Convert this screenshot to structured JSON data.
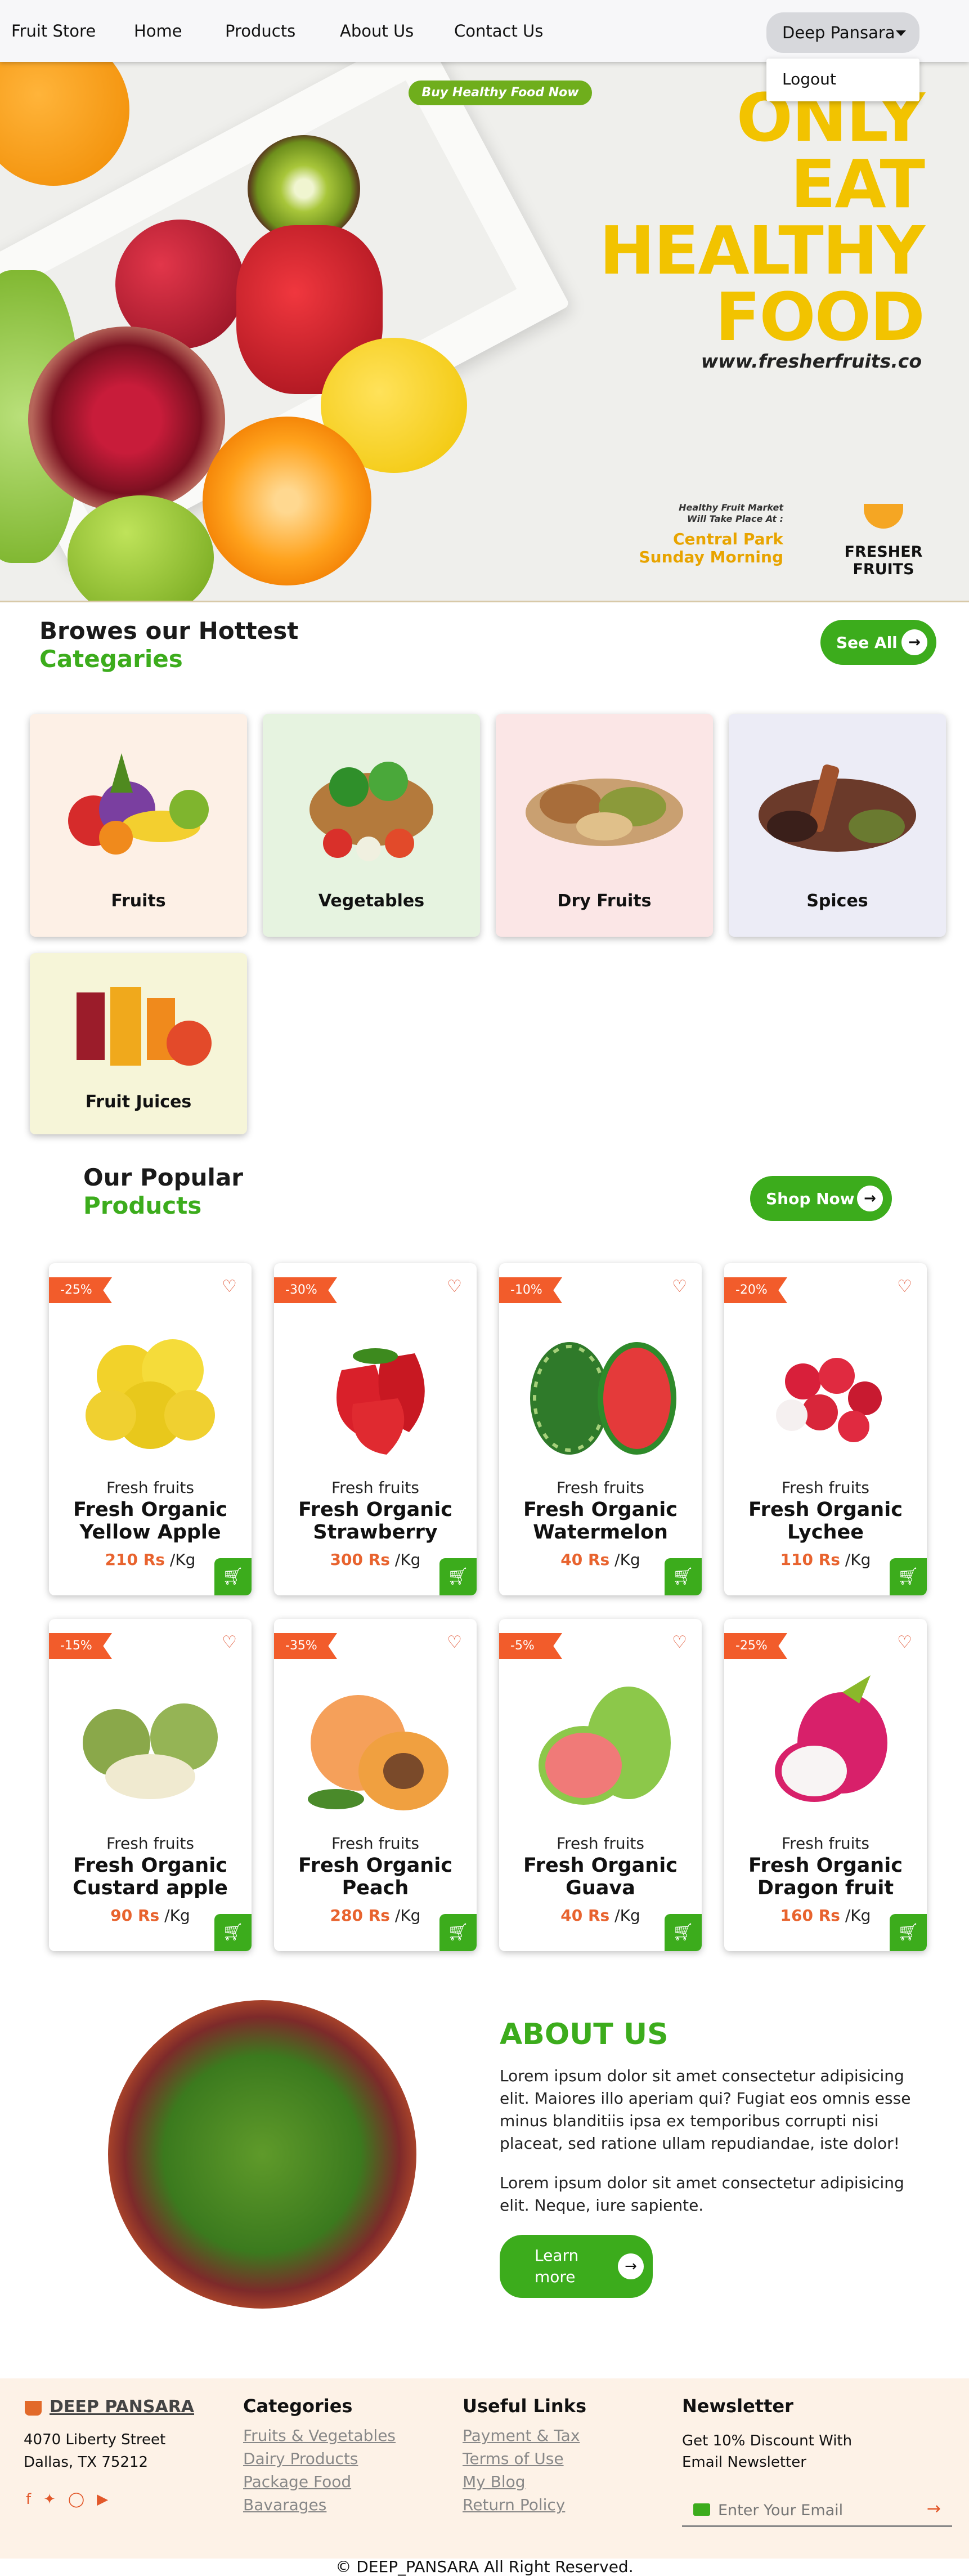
{
  "nav": {
    "brand": "Fruit Store",
    "items": [
      "Home",
      "Products",
      "About Us",
      "Contact Us"
    ],
    "user_name": "Deep Pansara",
    "dropdown_item": "Logout"
  },
  "hero": {
    "badge": "Buy Healthy Food Now",
    "title_lines": [
      "ONLY",
      "EAT",
      "HEALTHY",
      "FOOD"
    ],
    "url": "www.fresherfruits.co",
    "market_line1": "Healthy Fruit Market",
    "market_line2": "Will Take Place At :",
    "market_line3": "Central Park",
    "market_line4": "Sunday Morning",
    "logo_text": "FRESHER FRUITS"
  },
  "categories": {
    "title_line1": "Browes our Hottest",
    "title_line2": "Categaries",
    "button": "See All",
    "items": [
      {
        "label": "Fruits",
        "bg": "#fdf0e6"
      },
      {
        "label": "Vegetables",
        "bg": "#e6f3e0"
      },
      {
        "label": "Dry Fruits",
        "bg": "#fbe6e6"
      },
      {
        "label": "Spices",
        "bg": "#ececf6"
      },
      {
        "label": "Fruit Juices",
        "bg": "#f6f5d8"
      }
    ]
  },
  "products": {
    "title_line1": "Our Popular",
    "title_line2": "Products",
    "button": "Shop Now",
    "items": [
      {
        "discount": "-25%",
        "category": "Fresh fruits",
        "name1": "Fresh Organic",
        "name2": "Yellow Apple",
        "price": "210 Rs",
        "unit": "/Kg"
      },
      {
        "discount": "-30%",
        "category": "Fresh fruits",
        "name1": "Fresh Organic",
        "name2": "Strawberry",
        "price": "300 Rs",
        "unit": "/Kg"
      },
      {
        "discount": "-10%",
        "category": "Fresh fruits",
        "name1": "Fresh Organic",
        "name2": "Watermelon",
        "price": "40 Rs",
        "unit": "/Kg"
      },
      {
        "discount": "-20%",
        "category": "Fresh fruits",
        "name1": "Fresh Organic",
        "name2": "Lychee",
        "price": "110 Rs",
        "unit": "/Kg"
      },
      {
        "discount": "-15%",
        "category": "Fresh fruits",
        "name1": "Fresh Organic",
        "name2": "Custard apple",
        "price": "90 Rs",
        "unit": "/Kg"
      },
      {
        "discount": "-35%",
        "category": "Fresh fruits",
        "name1": "Fresh Organic",
        "name2": "Peach",
        "price": "280 Rs",
        "unit": "/Kg"
      },
      {
        "discount": "-5%",
        "category": "Fresh fruits",
        "name1": "Fresh Organic",
        "name2": "Guava",
        "price": "40 Rs",
        "unit": "/Kg"
      },
      {
        "discount": "-25%",
        "category": "Fresh fruits",
        "name1": "Fresh Organic",
        "name2": "Dragon fruit",
        "price": "160 Rs",
        "unit": "/Kg"
      }
    ]
  },
  "about": {
    "title": "ABOUT US",
    "para1": "Lorem ipsum dolor sit amet consectetur adipisicing elit. Maiores illo aperiam qui? Fugiat eos omnis esse minus blanditiis ipsa ex temporibus corrupti nisi placeat, sed ratione ullam repudiandae, iste dolor!",
    "para2": "Lorem ipsum dolor sit amet consectetur adipisicing elit. Neque, iure sapiente.",
    "button_line1": "Learn",
    "button_line2": "more"
  },
  "footer": {
    "brand": "DEEP PANSARA",
    "address1": "4070 Liberty Street",
    "address2": "Dallas, TX 75212",
    "categories_title": "Categories",
    "categories": [
      "Fruits & Vegetables",
      "Dairy Products",
      "Package Food",
      "Bavarages"
    ],
    "links_title": "Useful Links",
    "links": [
      "Payment & Tax",
      "Terms of Use",
      "My Blog",
      "Return Policy"
    ],
    "newsletter_title": "Newsletter",
    "newsletter_text1": "Get 10% Discount With",
    "newsletter_text2": "Email Newsletter",
    "email_placeholder": "Enter Your Email",
    "copyright": "© DEEP_PANSARA All Right Reserved."
  },
  "colors": {
    "accent": "#3cac1c",
    "hero_yellow": "#f2c300",
    "discount": "#f25c2b",
    "price": "#e8632e"
  }
}
